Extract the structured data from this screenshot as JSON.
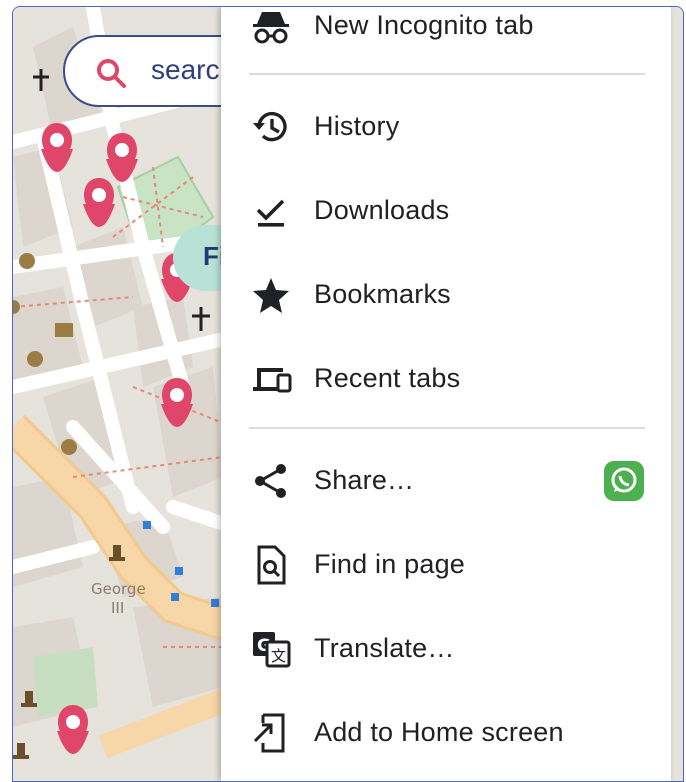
{
  "search": {
    "placeholder_text": "searcl"
  },
  "map": {
    "chip_text": "Fi",
    "statue_label_line1": "George",
    "statue_label_line2": "III"
  },
  "menu": {
    "items": [
      {
        "label": "New Incognito tab",
        "icon": "incognito-icon"
      },
      {
        "label": "History",
        "icon": "history-icon"
      },
      {
        "label": "Downloads",
        "icon": "downloads-icon"
      },
      {
        "label": "Bookmarks",
        "icon": "star-icon"
      },
      {
        "label": "Recent tabs",
        "icon": "devices-icon"
      },
      {
        "label": "Share…",
        "icon": "share-icon",
        "trailing_icon": "whatsapp-icon"
      },
      {
        "label": "Find in page",
        "icon": "find-in-page-icon"
      },
      {
        "label": "Translate…",
        "icon": "translate-icon"
      },
      {
        "label": "Add to Home screen",
        "icon": "add-to-home-icon"
      }
    ]
  },
  "colors": {
    "pin": "#e0456a",
    "park": "#c7dfc0",
    "road": "#f7c98b",
    "menu_text": "#202124"
  }
}
